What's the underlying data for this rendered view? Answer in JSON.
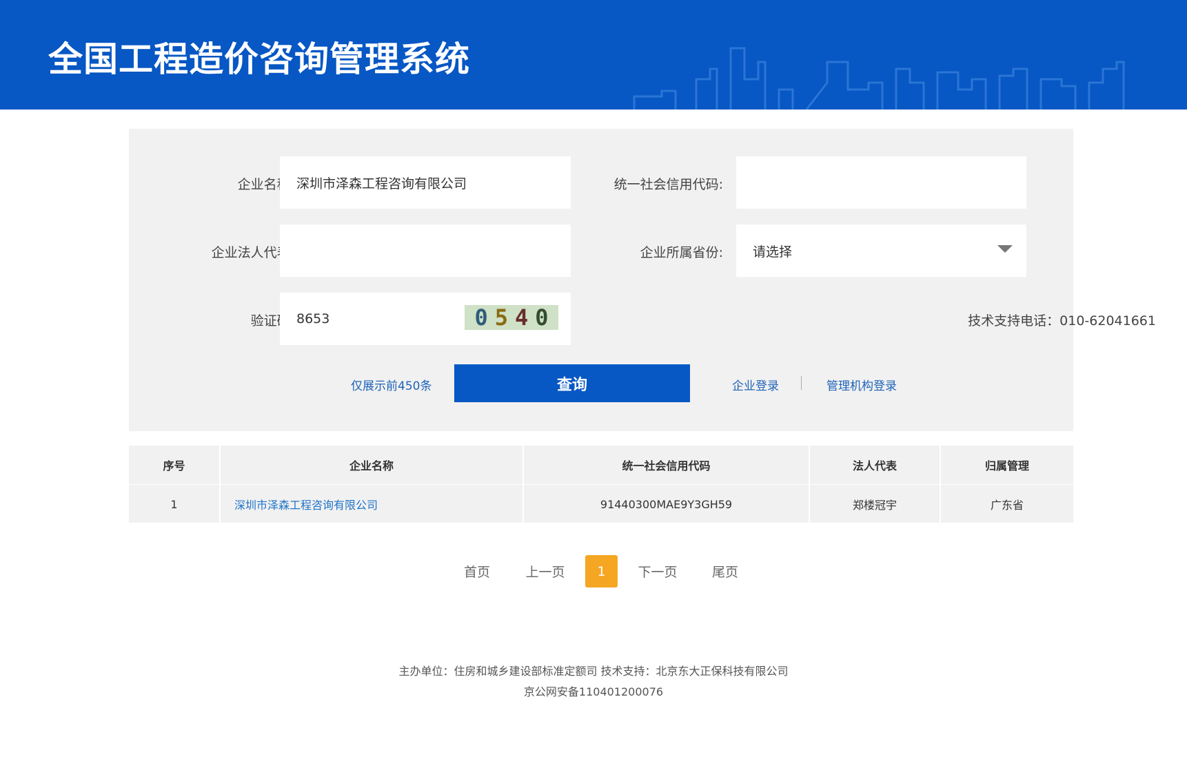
{
  "header": {
    "title": "全国工程造价咨询管理系统"
  },
  "form": {
    "company_name_label": "企业名称:",
    "company_name_value": "深圳市泽森工程咨询有限公司",
    "credit_code_label": "统一社会信用代码:",
    "credit_code_value": "",
    "legal_rep_label": "企业法人代表:",
    "legal_rep_value": "",
    "province_label": "企业所属省份:",
    "province_value": "请选择",
    "captcha_label": "验证码:",
    "captcha_value": "8653",
    "captcha_image_chars": [
      "0",
      "5",
      "4",
      "0"
    ],
    "support_phone": "技术支持电话：010-62041661",
    "limit_note": "仅展示前450条",
    "query_button": "查询",
    "company_login": "企业登录",
    "agency_login": "管理机构登录"
  },
  "table": {
    "columns": [
      "序号",
      "企业名称",
      "统一社会信用代码",
      "法人代表",
      "归属管理"
    ],
    "rows": [
      {
        "index": "1",
        "company": "深圳市泽森工程咨询有限公司",
        "credit_code": "91440300MAE9Y3GH59",
        "legal_rep": "郑楼冠宇",
        "province": "广东省"
      }
    ]
  },
  "pager": {
    "first": "首页",
    "prev": "上一页",
    "current": "1",
    "next": "下一页",
    "last": "尾页"
  },
  "footer": {
    "line1": "主办单位：住房和城乡建设部标准定额司 技术支持：北京东大正保科技有限公司",
    "line2": "京公网安备110401200076"
  },
  "colors": {
    "brand_blue": "#0757c4",
    "link_blue": "#1e63b8",
    "pager_active": "#f5a623",
    "panel_bg": "#f1f1f1"
  }
}
